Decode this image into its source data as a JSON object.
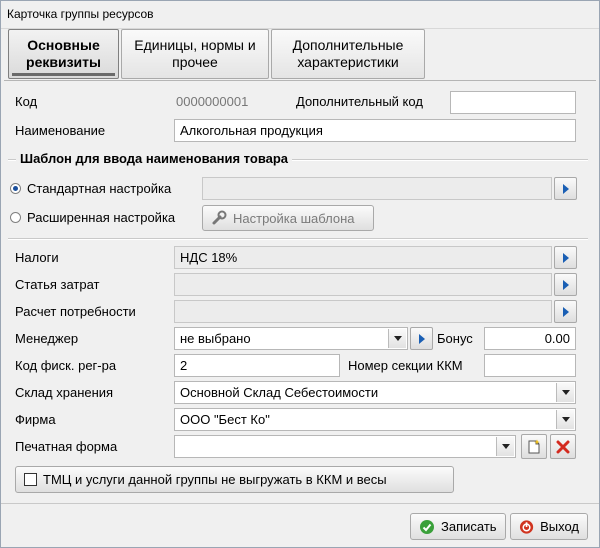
{
  "window": {
    "title": "Карточка группы ресурсов"
  },
  "tabs": [
    {
      "label_line1": "Основные",
      "label_line2": "реквизиты",
      "active": true
    },
    {
      "label_line1": "Единицы, нормы и",
      "label_line2": "прочее",
      "active": false
    },
    {
      "label_line1": "Дополнительные",
      "label_line2": "характеристики",
      "active": false
    }
  ],
  "code": {
    "label": "Код",
    "value": "0000000001"
  },
  "additional_code": {
    "label": "Дополнительный код",
    "value": ""
  },
  "name": {
    "label": "Наименование",
    "value": "Алкогольная продукция"
  },
  "template_section": {
    "title": "Шаблон для ввода наименования товара",
    "standard": {
      "label": "Стандартная настройка",
      "selected": true,
      "value": ""
    },
    "extended": {
      "label": "Расширенная настройка",
      "selected": false
    },
    "template_button": "Настройка шаблона"
  },
  "taxes": {
    "label": "Налоги",
    "value": "НДС 18%"
  },
  "cost_item": {
    "label": "Статья затрат",
    "value": ""
  },
  "demand_calc": {
    "label": "Расчет потребности",
    "value": ""
  },
  "manager": {
    "label": "Менеджер",
    "value": "не выбрано"
  },
  "bonus": {
    "label": "Бонус",
    "value": "0.00"
  },
  "fiscal_reg_code": {
    "label": "Код фиск. рег-ра",
    "value": "2"
  },
  "kkm_section": {
    "label": "Номер секции ККМ",
    "value": ""
  },
  "warehouse": {
    "label": "Склад хранения",
    "value": "Основной Склад Себестоимости"
  },
  "firm": {
    "label": "Фирма",
    "value": "ООО \"Бест Ко\""
  },
  "print_form": {
    "label": "Печатная форма",
    "value": ""
  },
  "no_export": {
    "label": "ТМЦ и услуги данной группы не выгружать в ККМ и весы",
    "checked": false
  },
  "footer": {
    "save_label": "Записать",
    "exit_label": "Выход"
  },
  "colors": {
    "accent_blue": "#1a5fb4",
    "delete_red": "#d42a1f",
    "save_green": "#3aa03a",
    "exit_red": "#d0341f"
  },
  "icons": [
    "arrow-right-icon",
    "wrench-icon",
    "dropdown-arrow-icon",
    "new-document-icon",
    "delete-icon",
    "checkmark-icon",
    "exit-icon"
  ]
}
